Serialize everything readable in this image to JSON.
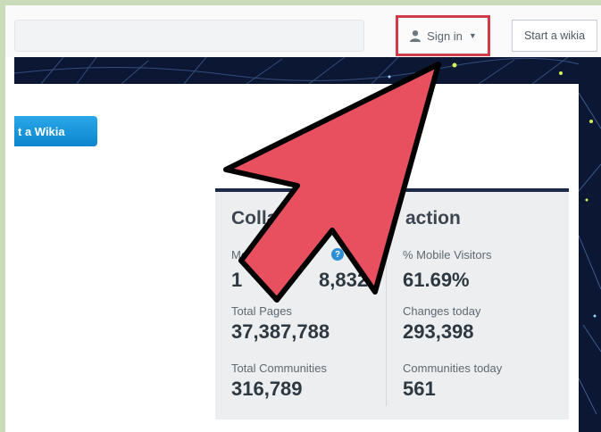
{
  "header": {
    "signin_label": "Sign in",
    "start_wikia_label": "Start a wikia"
  },
  "main": {
    "start_wikia_button_label": "t a Wikia"
  },
  "stats": {
    "title_left": "Colla",
    "title_right": "action",
    "monthly_label": "Mo",
    "monthly_value_prefix": "1",
    "monthly_value_suffix": "8,832",
    "mobile_visitors_label": "% Mobile Visitors",
    "mobile_visitors_value": "61.69%",
    "total_pages_label": "Total Pages",
    "total_pages_value": "37,387,788",
    "changes_today_label": "Changes today",
    "changes_today_value": "293,398",
    "total_communities_label": "Total Communities",
    "total_communities_value": "316,789",
    "communities_today_label": "Communities today",
    "communities_today_value": "561"
  },
  "colors": {
    "highlight_border": "#d23c49",
    "arrow_fill": "#e8505f",
    "button_blue": "#1497de",
    "banner_dark": "#0c1734",
    "frame_green": "#c9dbb8"
  },
  "icons": {
    "user": "user-icon",
    "chevron": "chevron-down-icon",
    "help": "help-icon",
    "arrow": "pointer-arrow-icon"
  }
}
